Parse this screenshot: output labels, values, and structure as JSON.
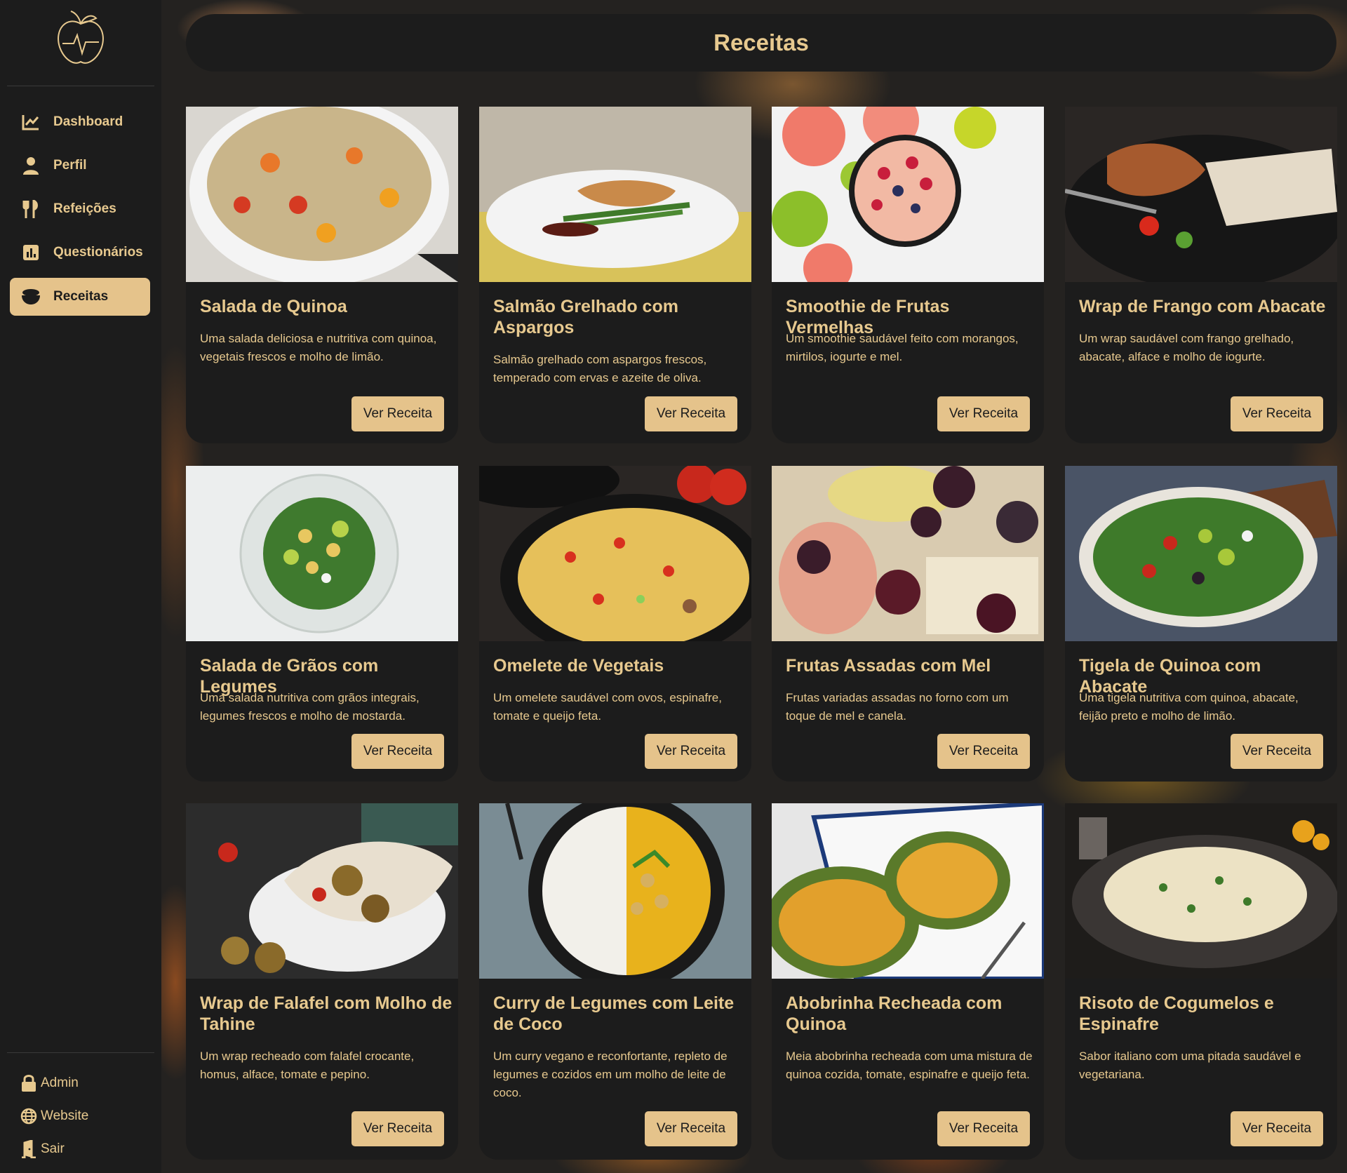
{
  "sidebar": {
    "items": [
      {
        "label": "Dashboard",
        "icon": "chart-line-icon"
      },
      {
        "label": "Perfil",
        "icon": "user-icon"
      },
      {
        "label": "Refeições",
        "icon": "utensils-icon"
      },
      {
        "label": "Questionários",
        "icon": "bar-chart-icon"
      },
      {
        "label": "Receitas",
        "icon": "bowl-icon",
        "active": true
      }
    ],
    "bottom": [
      {
        "label": "Admin",
        "icon": "lock-icon"
      },
      {
        "label": "Website",
        "icon": "globe-icon"
      },
      {
        "label": "Sair",
        "icon": "door-exit-icon"
      }
    ]
  },
  "header": {
    "title": "Receitas"
  },
  "recipes": [
    {
      "title": "Salada de Quinoa",
      "desc": "Uma salada deliciosa e nutritiva com quinoa, vegetais frescos e molho de limão.",
      "button": "Ver Receita"
    },
    {
      "title": "Salmão Grelhado com Aspargos",
      "desc": "Salmão grelhado com aspargos frescos, temperado com ervas e azeite de oliva.",
      "button": "Ver Receita"
    },
    {
      "title": "Smoothie de Frutas Vermelhas",
      "desc": "Um smoothie saudável feito com morangos, mirtilos, iogurte e mel.",
      "button": "Ver Receita"
    },
    {
      "title": "Wrap de Frango com Abacate",
      "desc": "Um wrap saudável com frango grelhado, abacate, alface e molho de iogurte.",
      "button": "Ver Receita"
    },
    {
      "title": "Salada de Grãos com Legumes",
      "desc": "Uma salada nutritiva com grãos integrais, legumes frescos e molho de mostarda.",
      "button": "Ver Receita"
    },
    {
      "title": "Omelete de Vegetais",
      "desc": "Um omelete saudável com ovos, espinafre, tomate e queijo feta.",
      "button": "Ver Receita"
    },
    {
      "title": "Frutas Assadas com Mel",
      "desc": "Frutas variadas assadas no forno com um toque de mel e canela.",
      "button": "Ver Receita"
    },
    {
      "title": "Tigela de Quinoa com Abacate",
      "desc": "Uma tigela nutritiva com quinoa, abacate, feijão preto e molho de limão.",
      "button": "Ver Receita"
    },
    {
      "title": "Wrap de Falafel com Molho de Tahine",
      "desc": "Um wrap recheado com falafel crocante, homus, alface, tomate e pepino.",
      "button": "Ver Receita"
    },
    {
      "title": "Curry de Legumes com Leite de Coco",
      "desc": "Um curry vegano e reconfortante, repleto de legumes e cozidos em um molho de leite de coco.",
      "button": "Ver Receita"
    },
    {
      "title": "Abobrinha Recheada com Quinoa",
      "desc": "Meia abobrinha recheada com uma mistura de quinoa cozida, tomate, espinafre e queijo feta.",
      "button": "Ver Receita"
    },
    {
      "title": "Risoto de Cogumelos e Espinafre",
      "desc": "Sabor italiano com uma pitada saudável e vegetariana.",
      "button": "Ver Receita"
    }
  ],
  "colors": {
    "accent": "#e5c38b",
    "panel": "#1c1c1c",
    "text": "#e7c98f"
  }
}
